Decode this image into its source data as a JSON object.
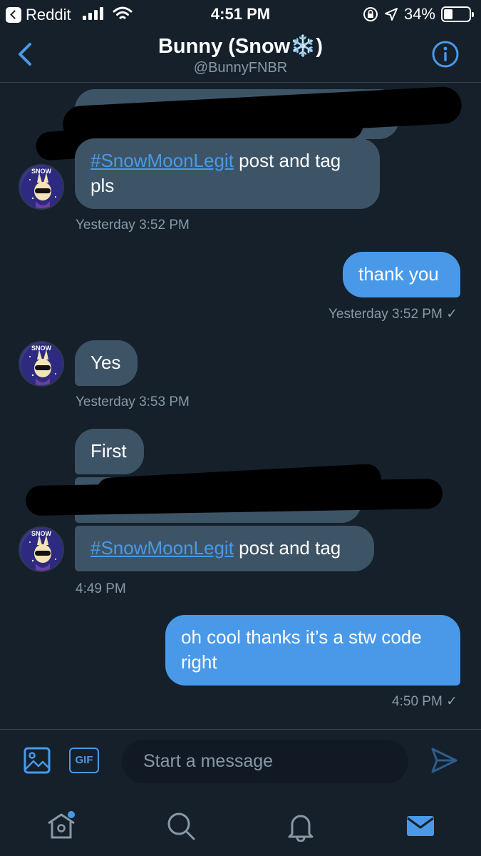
{
  "status_bar": {
    "back_app": "Reddit",
    "time": "4:51 PM",
    "battery": "34%",
    "battery_level": 0.34
  },
  "header": {
    "name": "Bunny (Snow❄️)",
    "handle": "@BunnyFNBR"
  },
  "messages": [
    {
      "side": "in",
      "hashtag": "#SnowMoonLegit",
      "text": " post and tag pls",
      "time": "Yesterday 3:52 PM"
    },
    {
      "side": "out",
      "text": "thank you",
      "time": "Yesterday 3:52 PM ✓"
    },
    {
      "side": "in",
      "text": "Yes",
      "time": "Yesterday 3:53 PM"
    },
    {
      "side": "in",
      "text": "First"
    },
    {
      "side": "in",
      "hashtag": "#SnowMoonLegit",
      "text": " post and tag",
      "time": "4:49 PM"
    },
    {
      "side": "out",
      "text": "oh cool thanks it’s a stw code right",
      "time": "4:50 PM ✓"
    }
  ],
  "composer": {
    "gif_label": "GIF",
    "placeholder": "Start a message"
  },
  "avatar_text": "SNOW",
  "colors": {
    "background": "#15202b",
    "incoming_bubble": "#3d5466",
    "outgoing_bubble": "#4a99e9",
    "accent": "#4a99e9",
    "muted": "#8899a6"
  },
  "icons": {
    "header": [
      "back-chevron-icon",
      "info-icon"
    ],
    "composer": [
      "image-icon",
      "gif-icon",
      "send-icon"
    ],
    "tabs": [
      "home-icon",
      "search-icon",
      "bell-icon",
      "mail-icon"
    ]
  }
}
